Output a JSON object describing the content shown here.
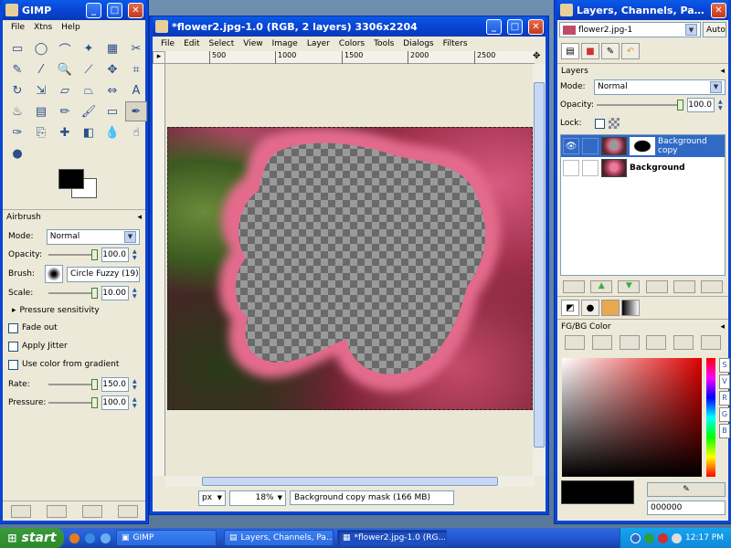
{
  "toolbox": {
    "title": "GIMP",
    "menu": [
      "File",
      "Xtns",
      "Help"
    ],
    "tools": [
      {
        "icon": "rect-select-icon",
        "glyph": "▭"
      },
      {
        "icon": "ellipse-select-icon",
        "glyph": "◯"
      },
      {
        "icon": "free-select-icon",
        "glyph": "⌒"
      },
      {
        "icon": "fuzzy-select-icon",
        "glyph": "✦"
      },
      {
        "icon": "color-select-icon",
        "glyph": "▦"
      },
      {
        "icon": "scissors-icon",
        "glyph": "✂"
      },
      {
        "icon": "paths-icon",
        "glyph": "✎"
      },
      {
        "icon": "color-picker-icon",
        "glyph": "⁄"
      },
      {
        "icon": "zoom-icon",
        "glyph": "🔍"
      },
      {
        "icon": "measure-icon",
        "glyph": "⟋"
      },
      {
        "icon": "move-icon",
        "glyph": "✥"
      },
      {
        "icon": "crop-icon",
        "glyph": "⌗"
      },
      {
        "icon": "rotate-icon",
        "glyph": "↻"
      },
      {
        "icon": "scale-icon",
        "glyph": "⇲"
      },
      {
        "icon": "shear-icon",
        "glyph": "▱"
      },
      {
        "icon": "perspective-icon",
        "glyph": "⏢"
      },
      {
        "icon": "flip-icon",
        "glyph": "⇔"
      },
      {
        "icon": "text-icon",
        "glyph": "A"
      },
      {
        "icon": "bucket-fill-icon",
        "glyph": "♨"
      },
      {
        "icon": "blend-icon",
        "glyph": "▤"
      },
      {
        "icon": "pencil-icon",
        "glyph": "✏"
      },
      {
        "icon": "paintbrush-icon",
        "glyph": "🖌"
      },
      {
        "icon": "eraser-icon",
        "glyph": "▭"
      },
      {
        "icon": "airbrush-icon",
        "glyph": "✒"
      },
      {
        "icon": "ink-icon",
        "glyph": "✑"
      },
      {
        "icon": "clone-icon",
        "glyph": "⎘"
      },
      {
        "icon": "heal-icon",
        "glyph": "✚"
      },
      {
        "icon": "perspective-clone-icon",
        "glyph": "◧"
      },
      {
        "icon": "blur-icon",
        "glyph": "💧"
      },
      {
        "icon": "smudge-icon",
        "glyph": "☝"
      },
      {
        "icon": "dodge-burn-icon",
        "glyph": "●"
      }
    ],
    "selected_tool": 23,
    "options": {
      "title": "Airbrush",
      "mode_label": "Mode:",
      "mode_value": "Normal",
      "opacity_label": "Opacity:",
      "opacity_value": "100.0",
      "brush_label": "Brush:",
      "brush_value": "Circle Fuzzy (19)",
      "scale_label": "Scale:",
      "scale_value": "10.00",
      "pressure_sensitivity": "Pressure sensitivity",
      "fade_out": "Fade out",
      "apply_jitter": "Apply Jitter",
      "use_gradient": "Use color from gradient",
      "rate_label": "Rate:",
      "rate_value": "150.0",
      "pressure_label": "Pressure:",
      "pressure_value": "100.0"
    }
  },
  "image_window": {
    "title": "*flower2.jpg-1.0 (RGB, 2 layers) 3306x2204",
    "menu": [
      "File",
      "Edit",
      "Select",
      "View",
      "Image",
      "Layer",
      "Colors",
      "Tools",
      "Dialogs",
      "Filters"
    ],
    "ruler_ticks": [
      "500",
      "1000",
      "1500",
      "2000",
      "2500"
    ],
    "unit": "px",
    "zoom": "18%",
    "status": "Background copy mask (166 MB)"
  },
  "layers_dialog": {
    "title": "Layers, Channels, Pat...",
    "image_select": "flower2.jpg-1",
    "auto_label": "Auto",
    "section_title": "Layers",
    "mode_label": "Mode:",
    "mode_value": "Normal",
    "opacity_label": "Opacity:",
    "opacity_value": "100.0",
    "lock_label": "Lock:",
    "layers": [
      {
        "name": "Background copy",
        "selected": true,
        "visible": true
      },
      {
        "name": "Background",
        "selected": false,
        "visible": false
      }
    ],
    "fgbg_title": "FG/BG Color",
    "hex_value": "000000",
    "channel_letters": [
      "S",
      "V",
      "R",
      "G",
      "B"
    ]
  },
  "taskbar": {
    "start": "start",
    "tasks": [
      {
        "label": "GIMP",
        "active": false
      },
      {
        "label": "Layers, Channels, Pa...",
        "active": false
      },
      {
        "label": "*flower2.jpg-1.0 (RG...",
        "active": true
      }
    ],
    "clock": "12:17 PM"
  },
  "colors": {
    "titlebar": "#0a46d6",
    "selected_layer": "#316ac5",
    "taskbar": "#245dda"
  }
}
